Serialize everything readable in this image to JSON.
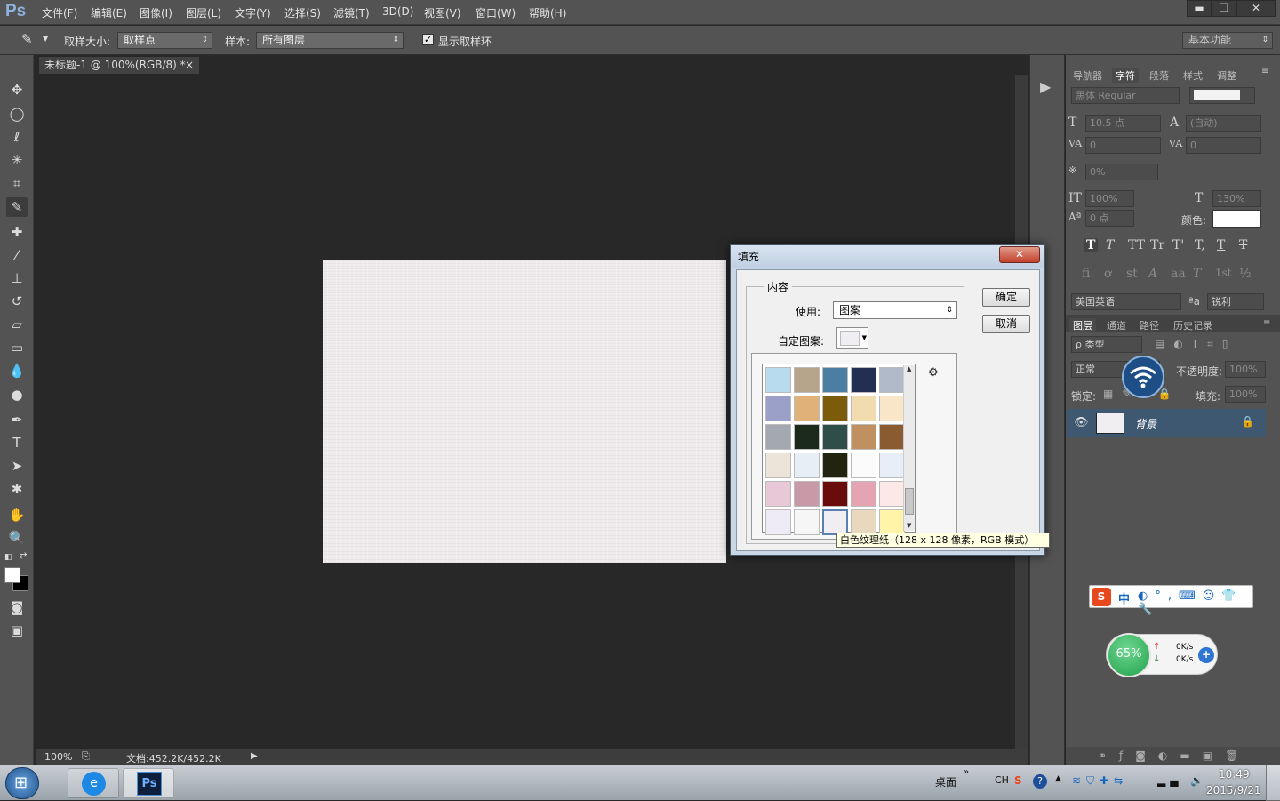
{
  "app": {
    "logo": "Ps"
  },
  "menu": [
    "文件(F)",
    "编辑(E)",
    "图像(I)",
    "图层(L)",
    "文字(Y)",
    "选择(S)",
    "滤镜(T)",
    "3D(D)",
    "视图(V)",
    "窗口(W)",
    "帮助(H)"
  ],
  "window_buttons": {
    "minimize": "▬",
    "restore": "❐",
    "close": "✕"
  },
  "options": {
    "sample_size_label": "取样大小:",
    "sample_size_value": "取样点",
    "sample_label": "样本:",
    "sample_value": "所有图层",
    "show_ring_label": "显示取样环",
    "show_ring_checked": true,
    "workspace": "基本功能"
  },
  "document": {
    "tab_title": "未标题-1 @ 100%(RGB/8) *",
    "tab_close": "×",
    "zoom": "100%",
    "doc_info": "文档:452.2K/452.2K"
  },
  "panels": {
    "top_tabs": [
      "导航器",
      "字符",
      "段落",
      "样式",
      "调整"
    ],
    "top_active": "字符",
    "character": {
      "font_family": "黑体",
      "font_style": "Regular",
      "font_size": "10.5 点",
      "leading": "(自动)",
      "kerning": "0",
      "tracking": "0",
      "tsume": "0%",
      "vscale": "100%",
      "hscale": "130%",
      "baseline": "0 点",
      "color_label": "颜色:",
      "style_buttons": [
        "T",
        "T",
        "TT",
        "Tr",
        "T'",
        "T,",
        "T",
        "T"
      ],
      "ot_buttons": [
        "fi",
        "ơ",
        "st",
        "A",
        "aa",
        "T",
        "1st",
        "½"
      ],
      "language": "美国英语",
      "aa_label": "ªa",
      "antialias": "锐利"
    },
    "layer_tabs": [
      "图层",
      "通道",
      "路径",
      "历史记录"
    ],
    "layer_active": "图层",
    "layers": {
      "filter_kind": "ρ 类型",
      "blend_mode": "正常",
      "opacity_label": "不透明度:",
      "opacity": "100%",
      "lock_label": "锁定:",
      "fill_label": "填充:",
      "fill": "100%",
      "items": [
        {
          "name": "背景",
          "visible": true,
          "locked": true
        }
      ]
    }
  },
  "dialog": {
    "title": "填充",
    "close": "✕",
    "group_label": "内容",
    "use_label": "使用:",
    "use_value": "图案",
    "custom_pattern_label": "自定图案:",
    "ok": "确定",
    "cancel": "取消",
    "tooltip": "白色纹理纸（128 x 128 像素，RGB 模式）",
    "swatch_colors": [
      [
        "#b8dced",
        "#b6a58a",
        "#4a7ea3",
        "#232f52",
        "#b0bac8"
      ],
      [
        "#9aa0c8",
        "#e0b27a",
        "#7b5c0a",
        "#f1dcb0",
        "#f9e6c8"
      ],
      [
        "#a4a8b0",
        "#1c2a1c",
        "#2f4e4a",
        "#c09060",
        "#8a5a30"
      ],
      [
        "#ece4d8",
        "#e8eef6",
        "#232410",
        "#fbfbfb",
        "#e8eef8"
      ],
      [
        "#e8c8d6",
        "#c89aa8",
        "#6a0c0c",
        "#e4a4b4",
        "#fde8e8"
      ],
      [
        "#eeeaf6",
        "#f6f6f6",
        "#f0eef2",
        "#e8d8c0",
        "#fff4a8"
      ]
    ],
    "selected_swatch": [
      5,
      2
    ]
  },
  "taskbar": {
    "desktop_label": "桌面",
    "ime": "CH",
    "time": "10:49",
    "date": "2015/9/21"
  },
  "sogou": {
    "label": "中"
  },
  "speed": {
    "percent": "65%",
    "up": "0K/s",
    "down": "0K/s"
  }
}
